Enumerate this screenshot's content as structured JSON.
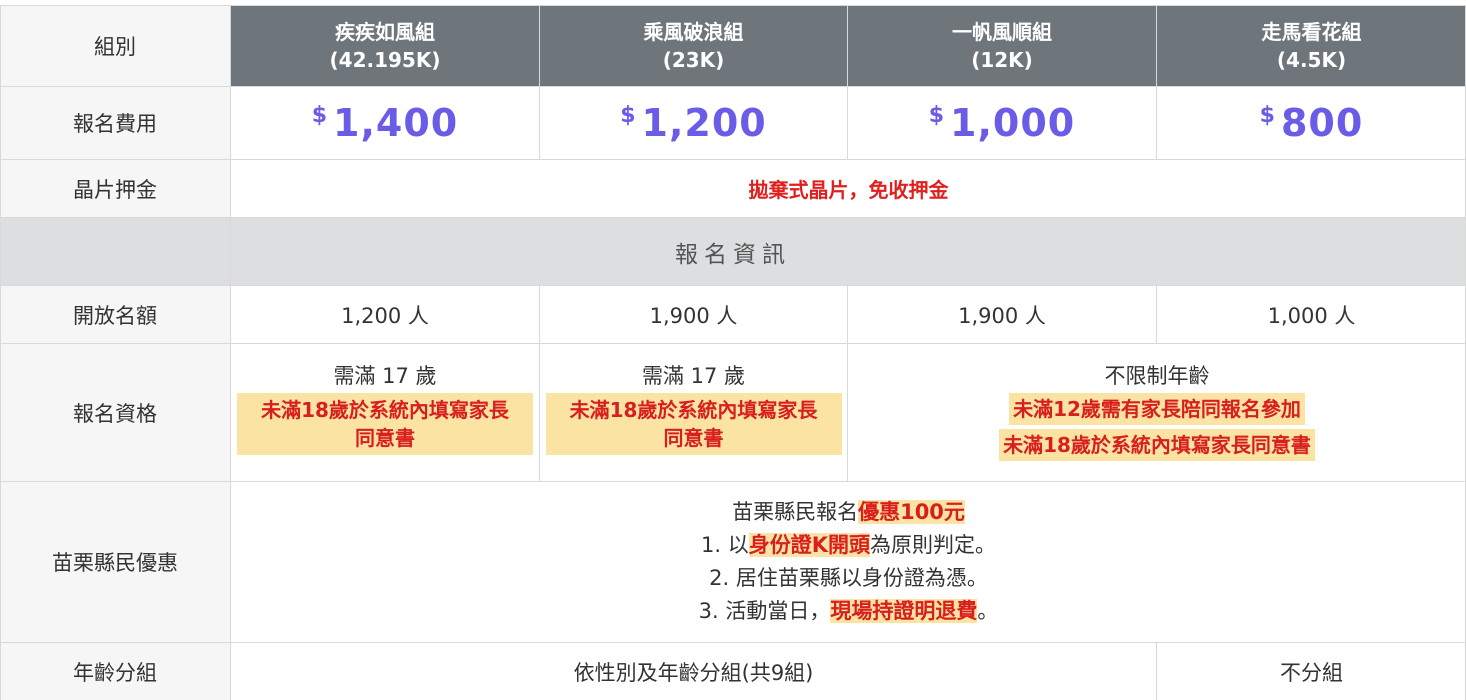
{
  "header": {
    "group_label": "組別",
    "groups": [
      {
        "name": "疾疾如風組",
        "distance": "(42.195K)"
      },
      {
        "name": "乘風破浪組",
        "distance": "(23K)"
      },
      {
        "name": "一帆風順組",
        "distance": "(12K)"
      },
      {
        "name": "走馬看花組",
        "distance": "(4.5K)"
      }
    ]
  },
  "fee": {
    "label": "報名費用",
    "currency": "$",
    "amounts": [
      "1,400",
      "1,200",
      "1,000",
      "800"
    ]
  },
  "chip": {
    "label": "晶片押金",
    "note": "拋棄式晶片，免收押金"
  },
  "section_title": "報名資訊",
  "quota": {
    "label": "開放名額",
    "values": [
      "1,200 人",
      "1,900 人",
      "1,900 人",
      "1,000 人"
    ]
  },
  "eligibility": {
    "label": "報名資格",
    "group1": {
      "age": "需滿 17 歲",
      "note_line1": "未滿18歲於系統內填寫家長",
      "note_line2": "同意書"
    },
    "group2": {
      "age": "需滿 17 歲",
      "note_line1": "未滿18歲於系統內填寫家長",
      "note_line2": "同意書"
    },
    "group34": {
      "age": "不限制年齡",
      "note_line1": "未滿12歲需有家長陪同報名參加",
      "note_line2": "未滿18歲於系統內填寫家長同意書"
    }
  },
  "resident": {
    "label": "苗栗縣民優惠",
    "line1_prefix": "苗栗縣民報名",
    "line1_highlight": "優惠100元",
    "line2_prefix": "1. 以",
    "line2_highlight": "身份證K開頭",
    "line2_suffix": "為原則判定。",
    "line3": "2. 居住苗栗縣以身份證為憑。",
    "line4_prefix": "3. 活動當日，",
    "line4_highlight": "現場持證明退費",
    "line4_suffix": "。"
  },
  "age_group": {
    "label": "年齡分組",
    "grouped": "依性別及年齡分組(共9組)",
    "ungrouped": "不分組"
  },
  "colors": {
    "header_bg": "#6e767c",
    "price": "#6a5ce7",
    "red_text": "#e0201e",
    "highlight_bg": "#fbe3a3",
    "section_bg": "#dcdee0"
  }
}
